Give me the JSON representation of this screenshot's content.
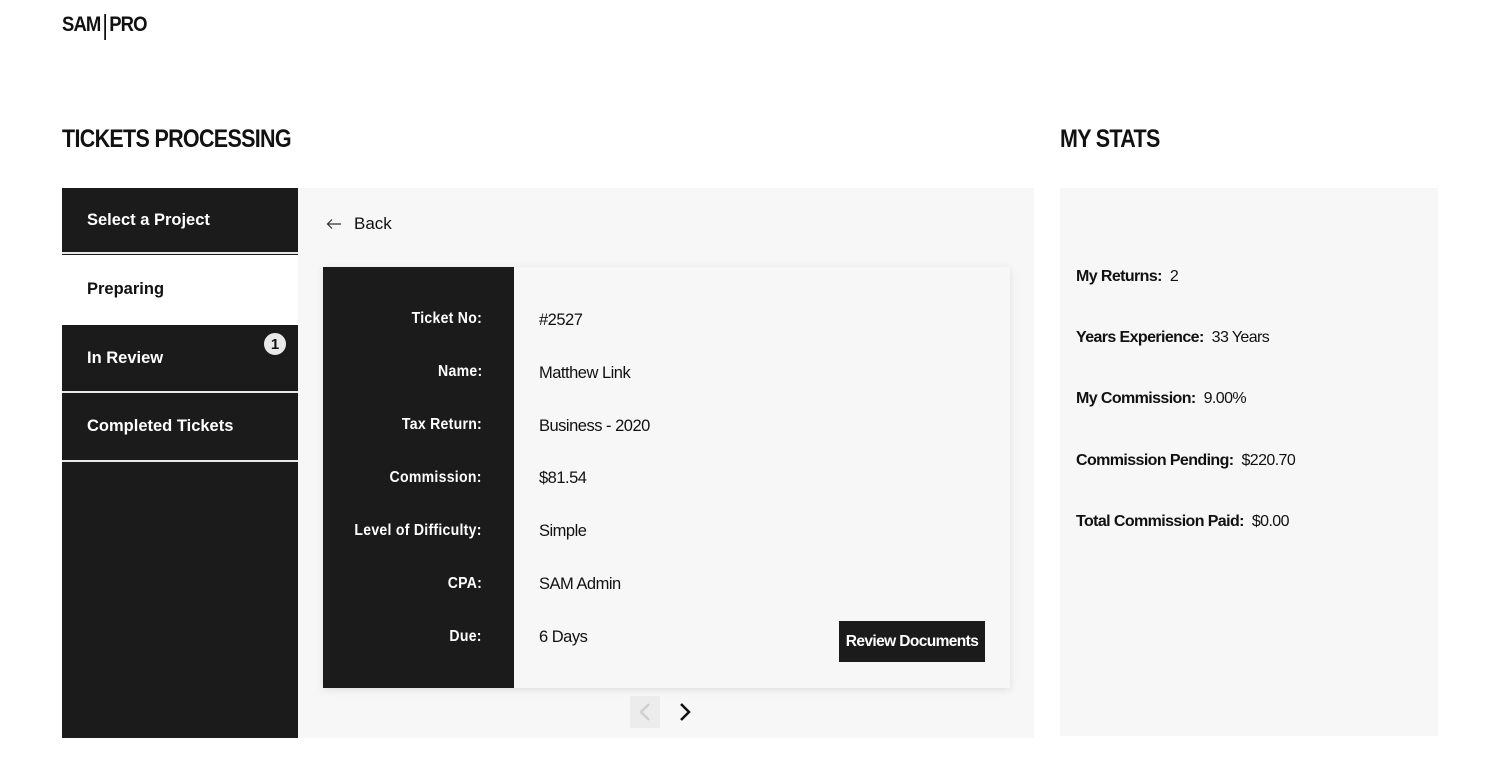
{
  "logo": {
    "left": "SAM",
    "right": "PRO"
  },
  "tickets_title": "TICKETS PROCESSING",
  "stats_title": "MY STATS",
  "sidebar": {
    "items": [
      {
        "label": "Select a Project",
        "active": false
      },
      {
        "label": "Preparing",
        "active": true
      },
      {
        "label": "In Review",
        "active": false,
        "badge": "1"
      },
      {
        "label": "Completed Tickets",
        "active": false
      }
    ]
  },
  "main": {
    "back_label": "Back",
    "ticket": {
      "fields": [
        {
          "label": "Ticket No:",
          "value": "#2527"
        },
        {
          "label": "Name:",
          "value": "Matthew Link"
        },
        {
          "label": "Tax Return:",
          "value": "Business - 2020"
        },
        {
          "label": "Commission:",
          "value": "$81.54"
        },
        {
          "label": "Level of Difficulty:",
          "value": "Simple"
        },
        {
          "label": "CPA:",
          "value": "SAM Admin"
        },
        {
          "label": "Due:",
          "value": "6 Days"
        }
      ],
      "review_button": "Review Documents"
    }
  },
  "stats": [
    {
      "label": "My Returns:",
      "value": "2"
    },
    {
      "label": "Years Experience:",
      "value": "33 Years"
    },
    {
      "label": "My Commission:",
      "value": "9.00%"
    },
    {
      "label": "Commission Pending:",
      "value": "$220.70"
    },
    {
      "label": "Total Commission Paid:",
      "value": "$0.00"
    }
  ],
  "colors": {
    "dark": "#1b1b1b",
    "panel": "#f7f7f7",
    "text": "#111111"
  }
}
